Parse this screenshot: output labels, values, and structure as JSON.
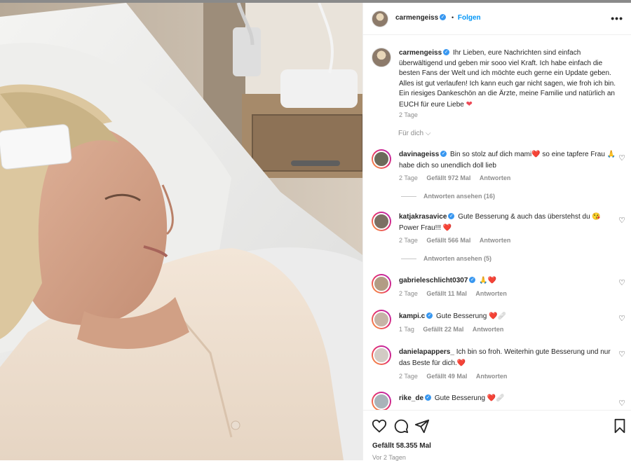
{
  "post": {
    "author": "carmengeiss",
    "follow_label": "Folgen",
    "more_label": "•••",
    "caption_author": "carmengeiss",
    "caption_text": "Ihr Lieben, eure Nachrichten sind einfach überwältigend und geben mir sooo viel Kraft. Ich habe einfach die besten Fans der Welt und ich möchte euch gerne ein Update geben. Alles ist gut verlaufen! Ich kann euch gar nicht sagen, wie froh ich bin. Ein riesiges Dankeschön an die Ärzte, meine Familie und natürlich an EUCH für eure Liebe",
    "caption_emoji": "❤",
    "caption_time": "2 Tage",
    "for_you_label": "Für dich",
    "likes_label": "Gefällt 58.355 Mal",
    "time_ago": "Vor 2 Tagen"
  },
  "comments": [
    {
      "user": "davinageiss",
      "text": "Bin so stolz auf dich mami❤️ so eine tapfere Frau 🙏 habe dich so unendlich doll lieb",
      "time": "2 Tage",
      "likes": "Gefällt 972 Mal",
      "reply": "Antworten",
      "view_replies": "Antworten ansehen (16)"
    },
    {
      "user": "katjakrasavice",
      "text": "Gute Besserung & auch das überstehst du 😘 Power Frau!!! ❤️",
      "time": "2 Tage",
      "likes": "Gefällt 566 Mal",
      "reply": "Antworten",
      "view_replies": "Antworten ansehen (5)"
    },
    {
      "user": "gabrieleschlicht0307",
      "text": "🙏❤️",
      "time": "2 Tage",
      "likes": "Gefällt 11 Mal",
      "reply": "Antworten"
    },
    {
      "user": "kampi.c",
      "text": "Gute Besserung ❤️🩹",
      "time": "1 Tag",
      "likes": "Gefällt 22 Mal",
      "reply": "Antworten"
    },
    {
      "user": "danielapappers_",
      "text": "Ich bin so froh. Weiterhin gute Besserung und nur das Beste für dich.❤️",
      "time": "2 Tage",
      "likes": "Gefällt 49 Mal",
      "reply": "Antworten"
    },
    {
      "user": "rike_de",
      "text": "Gute Besserung ❤️🩹"
    }
  ],
  "icons": {
    "verified": "verified-badge-icon",
    "like": "heart-outline-icon",
    "comment": "speech-bubble-icon",
    "share": "paper-plane-icon",
    "save": "bookmark-icon",
    "more": "three-dots-icon",
    "chevron": "chevron-down-icon"
  },
  "colors": {
    "accent": "#0095f6",
    "verified": "#3897f0",
    "muted": "#8e8e8e",
    "text": "#262626",
    "heart": "#ed4956"
  }
}
